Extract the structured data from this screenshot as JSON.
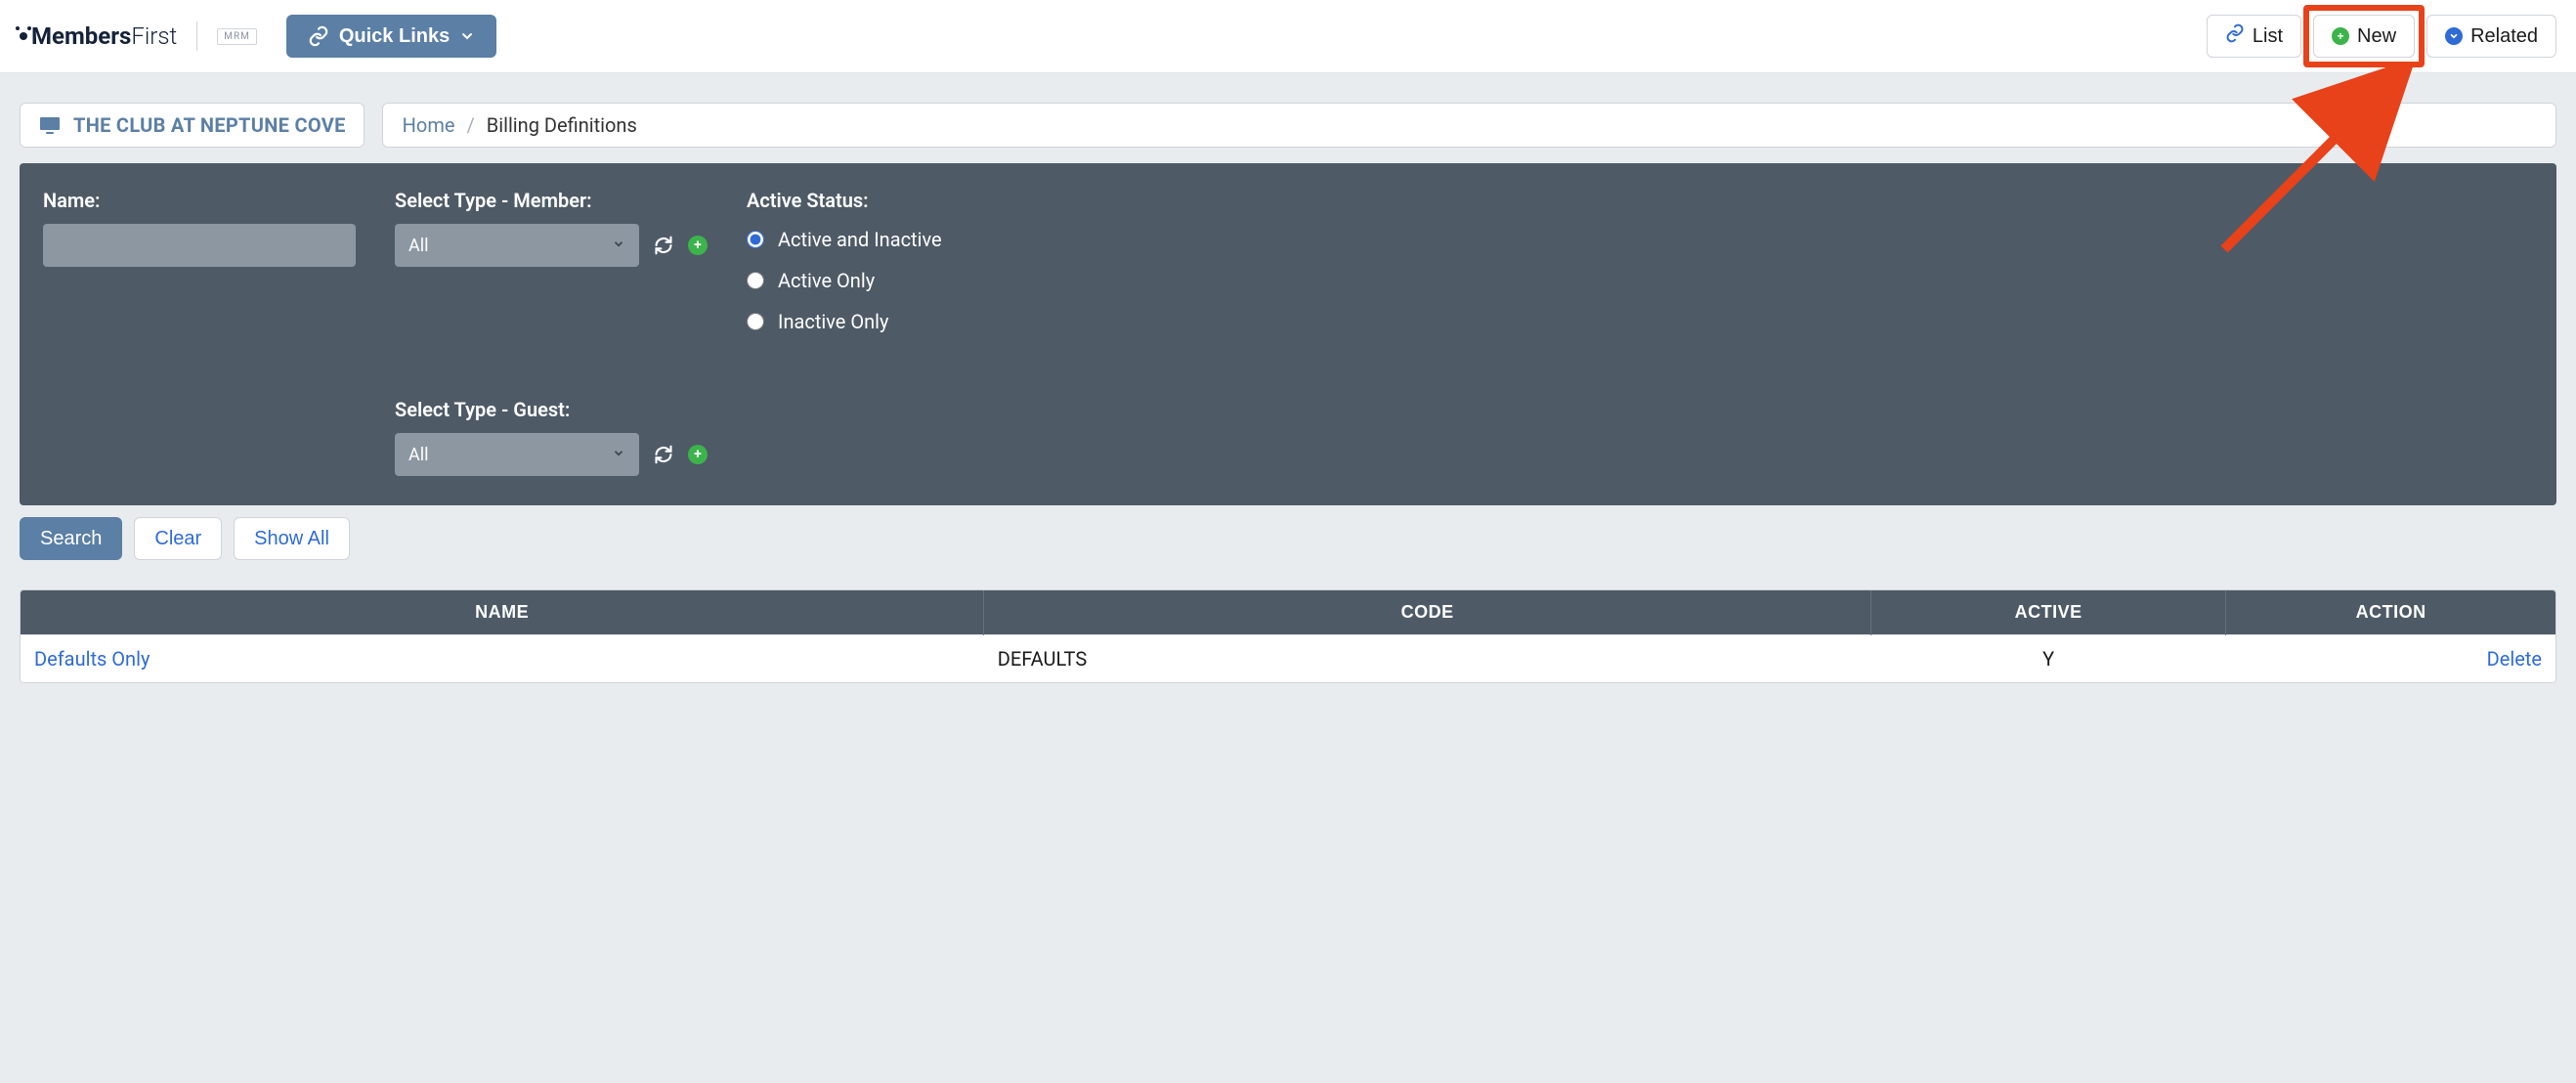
{
  "logo": {
    "brand_a": "Members",
    "brand_b": "First",
    "tag": "MRM"
  },
  "topbar": {
    "quick_links": "Quick Links",
    "list": "List",
    "new": "New",
    "related": "Related"
  },
  "club": {
    "name": "THE CLUB AT NEPTUNE COVE"
  },
  "breadcrumb": {
    "home": "Home",
    "current": "Billing Definitions"
  },
  "filters": {
    "name_label": "Name:",
    "member_type_label": "Select Type - Member:",
    "member_type_value": "All",
    "guest_type_label": "Select Type - Guest:",
    "guest_type_value": "All",
    "active_status_label": "Active Status:",
    "radios": {
      "both": "Active and Inactive",
      "active": "Active Only",
      "inactive": "Inactive Only"
    }
  },
  "actions": {
    "search": "Search",
    "clear": "Clear",
    "show_all": "Show All"
  },
  "table": {
    "headers": {
      "name": "NAME",
      "code": "CODE",
      "active": "ACTIVE",
      "action": "ACTION"
    },
    "rows": [
      {
        "name": "Defaults Only",
        "code": "DEFAULTS",
        "active": "Y",
        "action": "Delete"
      }
    ]
  }
}
